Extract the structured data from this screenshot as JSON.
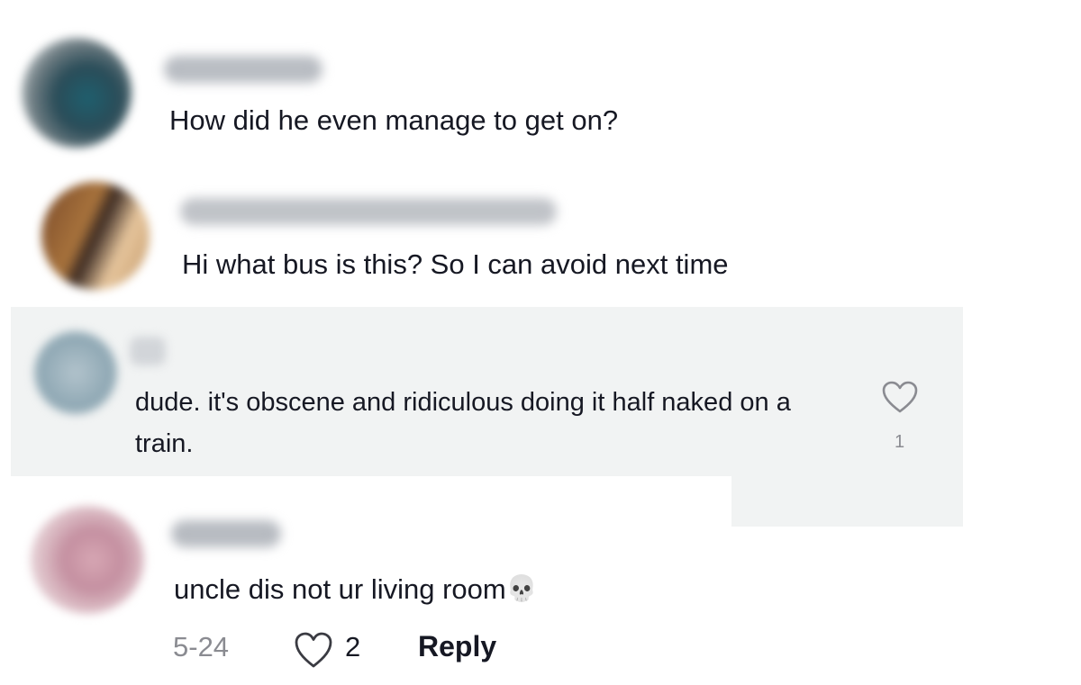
{
  "comments": [
    {
      "text": "How did he even manage to get on?"
    },
    {
      "text": "Hi what bus is this? So I can avoid next time"
    },
    {
      "text": "dude. it's obscene and ridiculous doing it half naked on a train.",
      "likes": "1",
      "highlighted": true
    },
    {
      "text": "uncle dis not ur living room",
      "emoji": "💀",
      "emoji_icon": "skull-emoji",
      "date": "5-24",
      "likes": "2",
      "reply_label": "Reply"
    }
  ],
  "colors": {
    "text": "#161823",
    "secondary_text": "#8a8b91",
    "highlight_background": "#f1f3f3"
  },
  "icons": [
    "heart-outline-icon"
  ]
}
